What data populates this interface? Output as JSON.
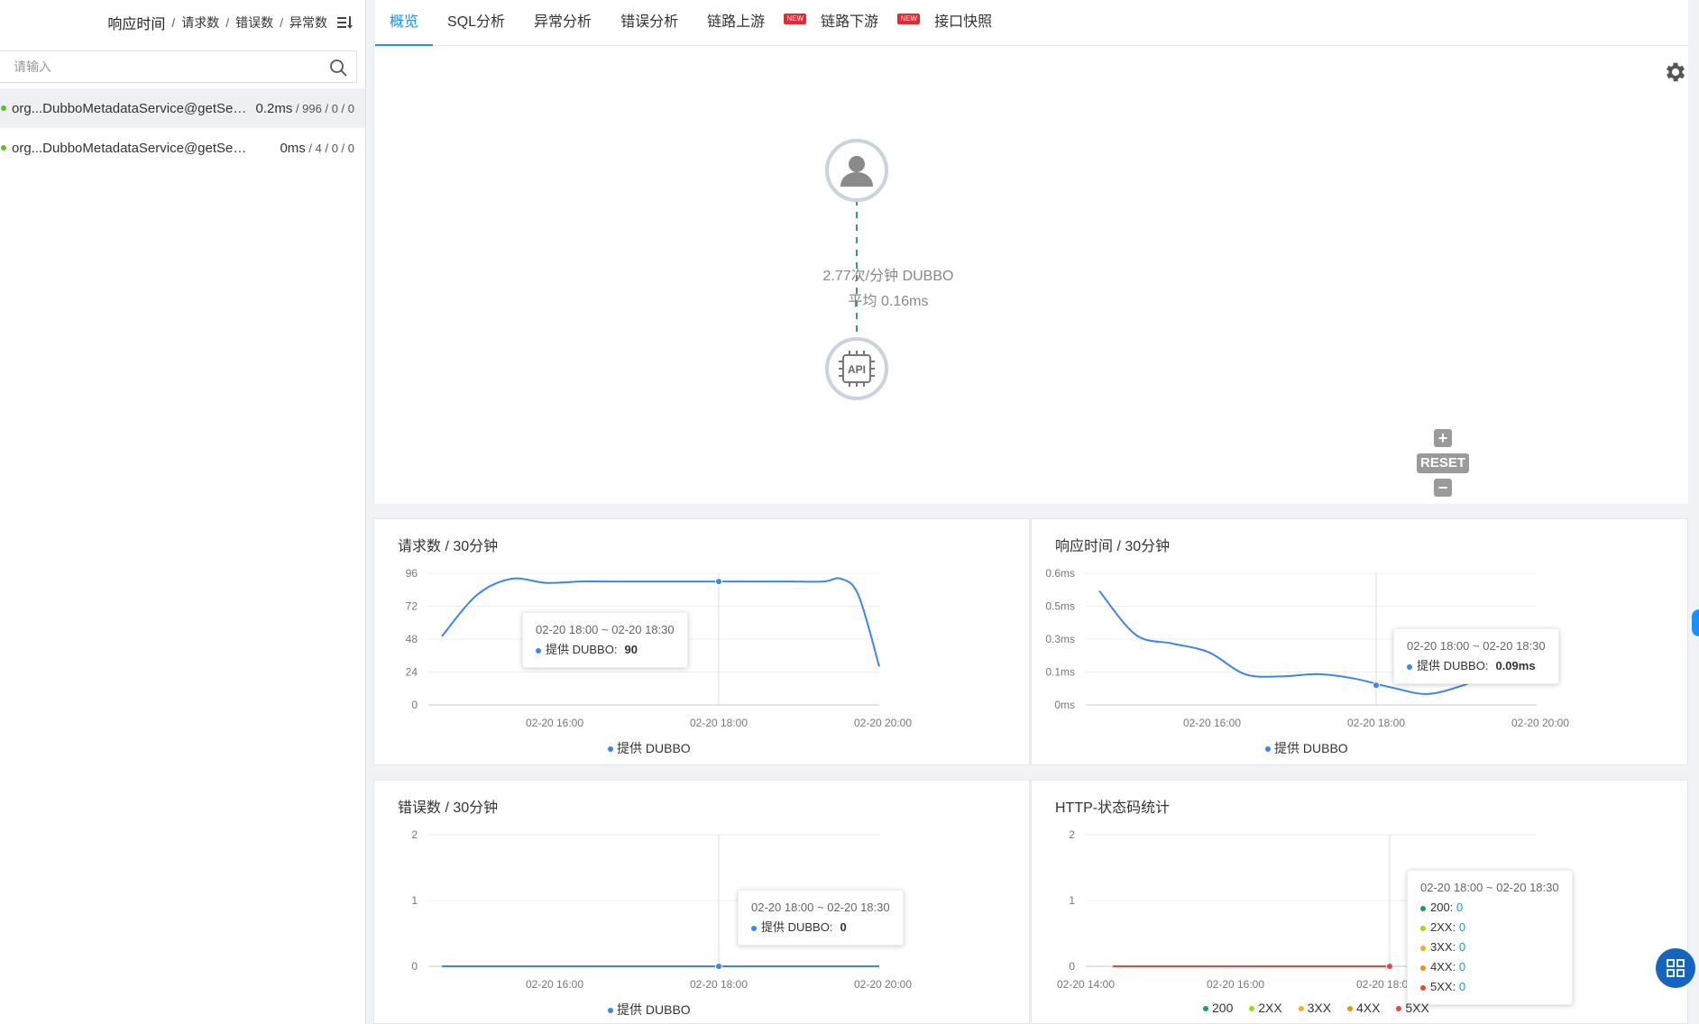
{
  "left": {
    "header": {
      "response_time": "响应时间",
      "requests": "请求数",
      "errors": "错误数",
      "exceptions": "异常数",
      "sep": "/"
    },
    "search": {
      "placeholder": "请输入"
    },
    "items": [
      {
        "name": "org...DubboMetadataService@getServiceRestMetadata",
        "rt": "0.2ms",
        "rest": " / 996 / 0 / 0",
        "active": true
      },
      {
        "name": "org...DubboMetadataService@getServiceRestMetadata",
        "rt": "0ms",
        "rest": " / 4 / 0 / 0",
        "active": false
      }
    ]
  },
  "tabs": [
    {
      "label": "概览",
      "active": true
    },
    {
      "label": "SQL分析"
    },
    {
      "label": "异常分析"
    },
    {
      "label": "错误分析"
    },
    {
      "label": "链路上游",
      "badge": "NEW"
    },
    {
      "label": "链路下游",
      "badge": "NEW"
    },
    {
      "label": "接口快照"
    }
  ],
  "topology": {
    "edge_rate": "2.77次/分钟 DUBBO",
    "edge_avg": "平均 0.16ms",
    "api_label": "API",
    "reset_label": "RESET",
    "zoom_in": "+",
    "zoom_out": "−"
  },
  "colors": {
    "accent": "#1890ff",
    "series_blue": "#3a86f0",
    "ok_green": "#52c41a",
    "code_200": "#13a266",
    "code_2xx": "#a0d911",
    "code_3xx": "#faad14",
    "code_4xx": "#fa8c16",
    "code_5xx": "#e8473f"
  },
  "chart_data": [
    {
      "type": "line",
      "title": "请求数 / 30分钟",
      "x_ticks": [
        "02-20 16:00",
        "02-20 18:00",
        "02-20 20:00"
      ],
      "y_ticks": [
        "0",
        "24",
        "48",
        "72",
        "96"
      ],
      "ylim": [
        0,
        96
      ],
      "series": [
        {
          "name": "提供 DUBBO",
          "x": [
            0,
            0.5,
            1.0,
            1.5,
            2.0,
            2.5,
            3.0,
            3.5,
            4.0,
            4.5,
            5.0,
            5.5,
            5.75,
            6.0,
            6.3
          ],
          "values": [
            50,
            80,
            92,
            89,
            90,
            90,
            90,
            90,
            90,
            90,
            90,
            90,
            92,
            80,
            28
          ]
        }
      ],
      "tooltip": {
        "time": "02-20 18:00 ~ 02-20 18:30",
        "series": "提供 DUBBO:",
        "value": "90"
      },
      "legend": [
        "提供 DUBBO"
      ]
    },
    {
      "type": "line",
      "title": "响应时间 / 30分钟",
      "x_ticks": [
        "02-20 16:00",
        "02-20 18:00",
        "02-20 20:00"
      ],
      "y_ticks": [
        "0ms",
        "0.1ms",
        "0.3ms",
        "0.5ms",
        "0.6ms"
      ],
      "ylim": [
        0,
        0.6
      ],
      "series": [
        {
          "name": "提供 DUBBO",
          "x": [
            0,
            0.5,
            1.0,
            1.5,
            2.0,
            2.5,
            3.0,
            3.5,
            4.0,
            4.5,
            5.0,
            5.5,
            6.0
          ],
          "values": [
            0.52,
            0.32,
            0.28,
            0.24,
            0.14,
            0.13,
            0.14,
            0.12,
            0.08,
            0.05,
            0.09,
            0.15,
            0.1
          ]
        }
      ],
      "tooltip": {
        "time": "02-20 18:00 ~ 02-20 18:30",
        "series": "提供 DUBBO:",
        "value": "0.09ms"
      },
      "legend": [
        "提供 DUBBO"
      ]
    },
    {
      "type": "line",
      "title": "错误数 / 30分钟",
      "x_ticks": [
        "02-20 16:00",
        "02-20 18:00",
        "02-20 20:00"
      ],
      "y_ticks": [
        "0",
        "1",
        "2"
      ],
      "ylim": [
        0,
        2
      ],
      "series": [
        {
          "name": "提供 DUBBO",
          "x": [
            0,
            3.0,
            6.0
          ],
          "values": [
            0,
            0,
            0
          ]
        }
      ],
      "tooltip": {
        "time": "02-20 18:00 ~ 02-20 18:30",
        "series": "提供 DUBBO:",
        "value": "0"
      },
      "legend": [
        "提供 DUBBO"
      ]
    },
    {
      "type": "line",
      "title": "HTTP-状态码统计",
      "x_ticks": [
        "02-20 14:00",
        "02-20 16:00",
        "02-20 18:00",
        "02-20 20:00"
      ],
      "y_ticks": [
        "0",
        "1",
        "2"
      ],
      "ylim": [
        0,
        2
      ],
      "series": [
        {
          "name": "200",
          "values": [
            0,
            0,
            0
          ]
        },
        {
          "name": "2XX",
          "values": [
            0,
            0,
            0
          ]
        },
        {
          "name": "3XX",
          "values": [
            0,
            0,
            0
          ]
        },
        {
          "name": "4XX",
          "values": [
            0,
            0,
            0
          ]
        },
        {
          "name": "5XX",
          "values": [
            0,
            0,
            0
          ]
        }
      ],
      "tooltip": {
        "time": "02-20 18:00 ~ 02-20 18:30",
        "rows": [
          {
            "name": "200:",
            "value": "0"
          },
          {
            "name": "2XX:",
            "value": "0"
          },
          {
            "name": "3XX:",
            "value": "0"
          },
          {
            "name": "4XX:",
            "value": "0"
          },
          {
            "name": "5XX:",
            "value": "0"
          }
        ]
      },
      "legend": [
        "200",
        "2XX",
        "3XX",
        "4XX",
        "5XX"
      ]
    }
  ]
}
